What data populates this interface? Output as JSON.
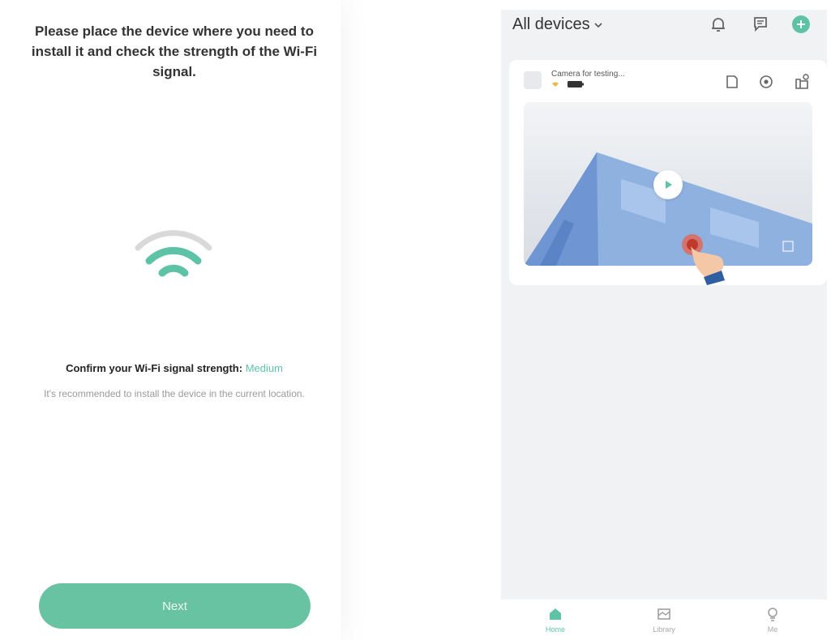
{
  "left": {
    "title": "Please place the device where you need to install it and check the strength of the Wi-Fi signal.",
    "signal_prompt": "Confirm your Wi-Fi signal strength:",
    "signal_level": "Medium",
    "hint": "It's recommended to install the device in the current location.",
    "next_label": "Next",
    "colors": {
      "accent": "#67c3a1",
      "wifi_weak": "#d9d9d9"
    }
  },
  "right": {
    "devices_label": "All devices",
    "device": {
      "name": "Camera for testing..."
    },
    "nav": [
      {
        "icon": "home-icon",
        "label": "Home",
        "active": true
      },
      {
        "icon": "library-icon",
        "label": "Library",
        "active": false
      },
      {
        "icon": "me-icon",
        "label": "Me",
        "active": false
      }
    ],
    "colors": {
      "accent": "#5ec3a6",
      "background": "#f1f2f4"
    }
  }
}
